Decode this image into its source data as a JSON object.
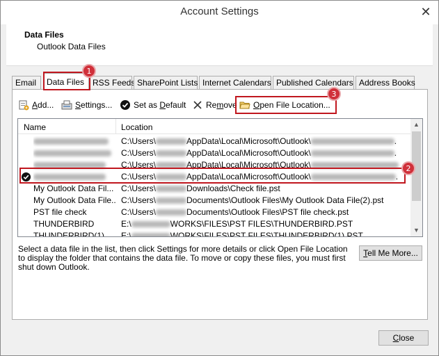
{
  "window": {
    "title": "Account Settings",
    "close_glyph": "✕"
  },
  "header": {
    "title": "Data Files",
    "subtitle": "Outlook Data Files"
  },
  "tabs": [
    {
      "label": "Email"
    },
    {
      "label": "Data Files"
    },
    {
      "label": "RSS Feeds"
    },
    {
      "label": "SharePoint Lists"
    },
    {
      "label": "Internet Calendars"
    },
    {
      "label": "Published Calendars"
    },
    {
      "label": "Address Books"
    }
  ],
  "toolbar": {
    "add": {
      "prefix": "A",
      "rest": "dd..."
    },
    "settings": {
      "prefix": "S",
      "rest": "ettings..."
    },
    "set_default": {
      "pre": "Set as ",
      "u": "D",
      "post": "efault"
    },
    "remove": {
      "pre": "Re",
      "u": "m",
      "post": "ove"
    },
    "open_location": {
      "u": "O",
      "post": "pen File Location..."
    }
  },
  "list": {
    "columns": {
      "name": "Name",
      "location": "Location"
    },
    "rows": [
      {
        "name": "",
        "loc_pre": "C:\\Users\\",
        "loc_post": "AppData\\Local\\Microsoft\\Outlook\\",
        "tail": "."
      },
      {
        "name": "",
        "loc_pre": "C:\\Users\\",
        "loc_post": "AppData\\Local\\Microsoft\\Outlook\\",
        "tail": "."
      },
      {
        "name": "",
        "loc_pre": "C:\\Users\\",
        "loc_post": "AppData\\Local\\Microsoft\\Outlook\\",
        "tail": ""
      },
      {
        "name": "",
        "loc_pre": "C:\\Users\\",
        "loc_post": "AppData\\Local\\Microsoft\\Outlook\\",
        "tail": "."
      },
      {
        "name": "My Outlook Data Fil...",
        "loc_pre": "C:\\Users\\",
        "loc_post": "Downloads\\Check file.pst",
        "tail": ""
      },
      {
        "name": "My Outlook Data File...",
        "loc_pre": "C:\\Users\\",
        "loc_post": "Documents\\Outlook Files\\My Outlook Data File(2).pst",
        "tail": ""
      },
      {
        "name": "PST file check",
        "loc_pre": "C:\\Users\\",
        "loc_post": "Documents\\Outlook Files\\PST file check.pst",
        "tail": ""
      },
      {
        "name": "THUNDERBIRD",
        "loc_pre": "E:\\",
        "loc_post": "WORKS\\FILES\\PST FILES\\THUNDERBIRD.PST",
        "tail": ""
      },
      {
        "name": "THUNDERBIRD(1)",
        "loc_pre": "E:\\",
        "loc_post": "WORKS\\FILES\\PST FILES\\THUNDERBIRD(1).PST",
        "tail": ""
      }
    ]
  },
  "description": "Select a data file in the list, then click Settings for more details or click Open File Location to display the folder that contains the data file. To move or copy these files, you must first shut down Outlook.",
  "tell_me_more": {
    "u": "T",
    "post": "ell Me More..."
  },
  "close_button": {
    "u": "C",
    "post": "lose"
  },
  "markers": [
    "1",
    "2",
    "3"
  ],
  "icons": {
    "add": "add-file-icon",
    "settings": "settings-icon",
    "default": "check-circle-icon",
    "remove": "x-remove-icon",
    "open": "folder-open-icon",
    "row_default": "check-circle-icon"
  },
  "colors": {
    "highlight": "#c0161e",
    "marker": "#d0303a"
  }
}
